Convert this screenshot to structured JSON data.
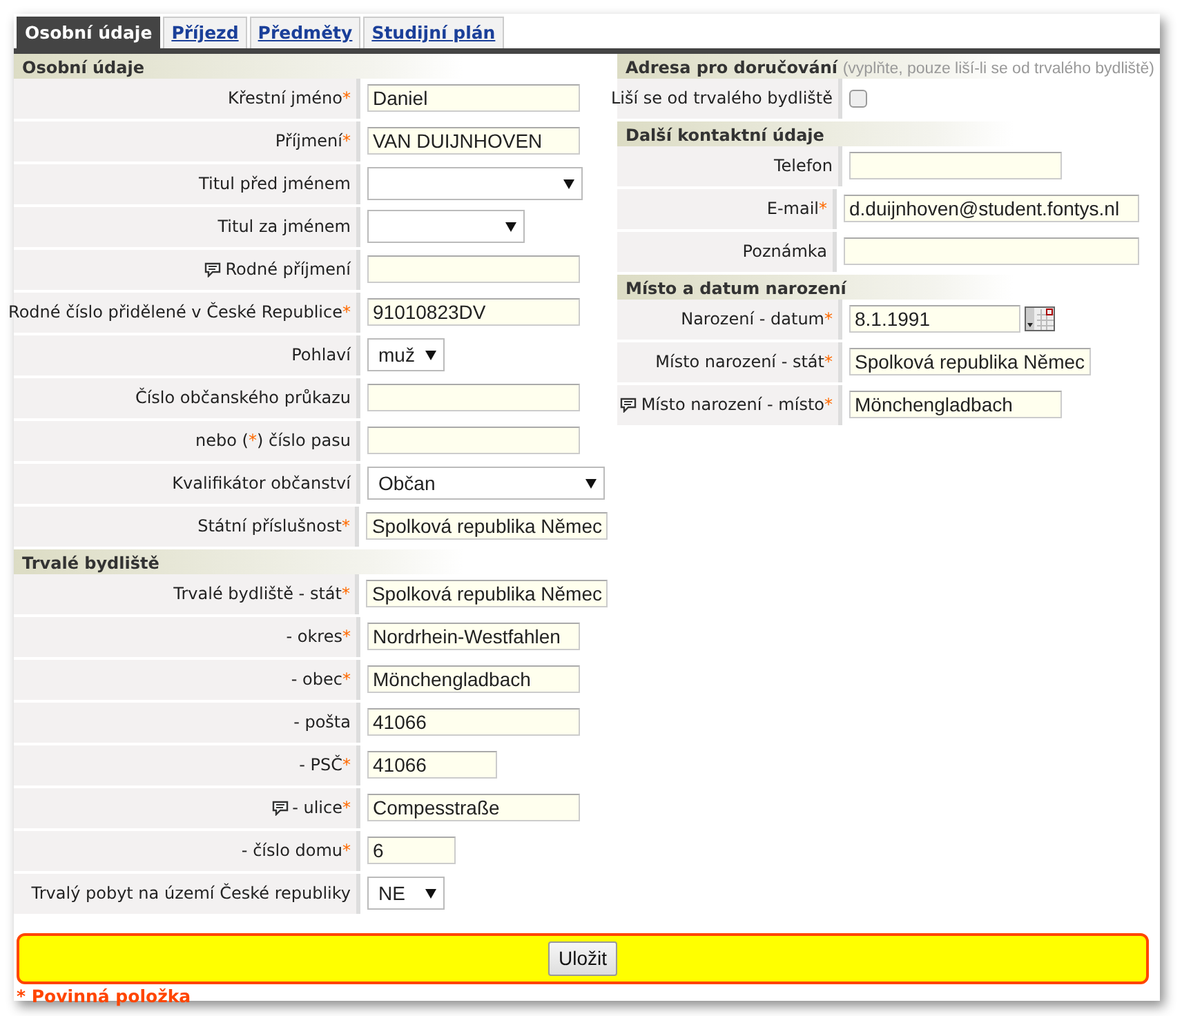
{
  "tabs": [
    {
      "label": "Osobní údaje",
      "selected": true
    },
    {
      "label": "Příjezd",
      "selected": false
    },
    {
      "label": "Předměty",
      "selected": false
    },
    {
      "label": "Studijní plán",
      "selected": false
    }
  ],
  "left_sections": [
    {
      "title": "Osobní údaje",
      "rows": [
        {
          "kind": "text",
          "label": "Křestní jméno",
          "required_mark": "*",
          "value": "Daniel"
        },
        {
          "kind": "text",
          "label": "Příjmení",
          "required_mark": "*",
          "value": "VAN DUIJNHOVEN"
        },
        {
          "kind": "select",
          "label": "Titul před jménem"
        },
        {
          "kind": "select",
          "label": "Titul za jménem"
        },
        {
          "kind": "text",
          "label": "Rodné příjmení",
          "note": true
        },
        {
          "kind": "text",
          "label": "Rodné číslo přidělené v České Republice",
          "required_mark": "*",
          "value": "91010823DV"
        },
        {
          "kind": "select",
          "label": "Pohlaví",
          "value": "muž"
        },
        {
          "kind": "text",
          "label": "Číslo občanského průkazu"
        },
        {
          "kind": "text",
          "label": "nebo (",
          "required_mark": "*",
          "label_after": ") číslo pasu"
        },
        {
          "kind": "select",
          "label": "Kvalifikátor občanství",
          "value": "Občan"
        },
        {
          "kind": "text",
          "label": "Státní příslušnost",
          "required_mark": "*",
          "value": "Spolková republika Němec"
        }
      ]
    },
    {
      "title": "Trvalé bydliště",
      "rows": [
        {
          "kind": "text",
          "label": "Trvalé bydliště - stát",
          "required_mark": "*",
          "value": "Spolková republika Němec"
        },
        {
          "kind": "text",
          "label": "- okres",
          "required_mark": "*",
          "value": "Nordrhein-Westfahlen"
        },
        {
          "kind": "text",
          "label": "- obec",
          "required_mark": "*",
          "value": "Mönchengladbach"
        },
        {
          "kind": "text",
          "label": "- pošta",
          "value": "41066"
        },
        {
          "kind": "text",
          "label": "- PSČ",
          "required_mark": "*",
          "value": "41066"
        },
        {
          "kind": "text",
          "label": "- ulice",
          "required_mark": "*",
          "note": true,
          "value": "Compesstraße"
        },
        {
          "kind": "text",
          "label": "- číslo domu",
          "required_mark": "*",
          "value": "6"
        },
        {
          "kind": "select",
          "label": "Trvalý pobyt na území České republiky",
          "value": "NE"
        }
      ]
    }
  ],
  "right_sections": [
    {
      "title": "Adresa pro doručování",
      "hint": "(vyplňte, pouze liší-li se od trvalého bydliště)",
      "rows": [
        {
          "kind": "checkbox",
          "label": "Liší se od trvalého bydliště",
          "checked": false
        }
      ]
    },
    {
      "title": "Další kontaktní údaje",
      "rows": [
        {
          "kind": "text",
          "label": "Telefon"
        },
        {
          "kind": "text",
          "label": "E-mail",
          "required_mark": "*",
          "value": "d.duijnhoven@student.fontys.nl"
        },
        {
          "kind": "text",
          "label": "Poznámka"
        }
      ]
    },
    {
      "title": "Místo a datum narození",
      "rows": [
        {
          "kind": "date",
          "label": "Narození - datum",
          "required_mark": "*",
          "value": "8.1.1991"
        },
        {
          "kind": "text",
          "label": "Místo narození - stát",
          "required_mark": "*",
          "value": "Spolková republika Němec"
        },
        {
          "kind": "text",
          "label": "Místo narození - místo",
          "required_mark": "*",
          "note": true,
          "value": "Mönchengladbach"
        }
      ]
    }
  ],
  "save_button": "Uložit",
  "required_legend": "* Povinná položka"
}
